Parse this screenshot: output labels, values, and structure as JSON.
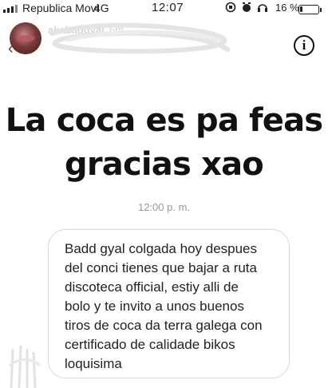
{
  "status_bar": {
    "carrier": "Republica Movi",
    "network": "4G",
    "time": "12:07",
    "battery_percent": "16 %",
    "battery_level": 0.16
  },
  "story": {
    "username": "akabadgyal",
    "time_ago": "6m"
  },
  "headline": {
    "line1": "La coca es pa feas",
    "line2": "gracias xao"
  },
  "message": {
    "timestamp": "12:00 p. m.",
    "text": "Badd gyal colgada hoy despues\ndel conci tienes que bajar a ruta\ndiscoteca official, estiy alli de\nbolo y te invito a unos buenos\ntiros de coca da terra galega con\ncertificado de calidade bikos\nloquisima"
  },
  "icons": {
    "back": "chevron-left-icon",
    "info": "info-icon",
    "alarm": "alarm-icon",
    "lock": "rotation-lock-icon",
    "headphones": "headphones-icon"
  }
}
